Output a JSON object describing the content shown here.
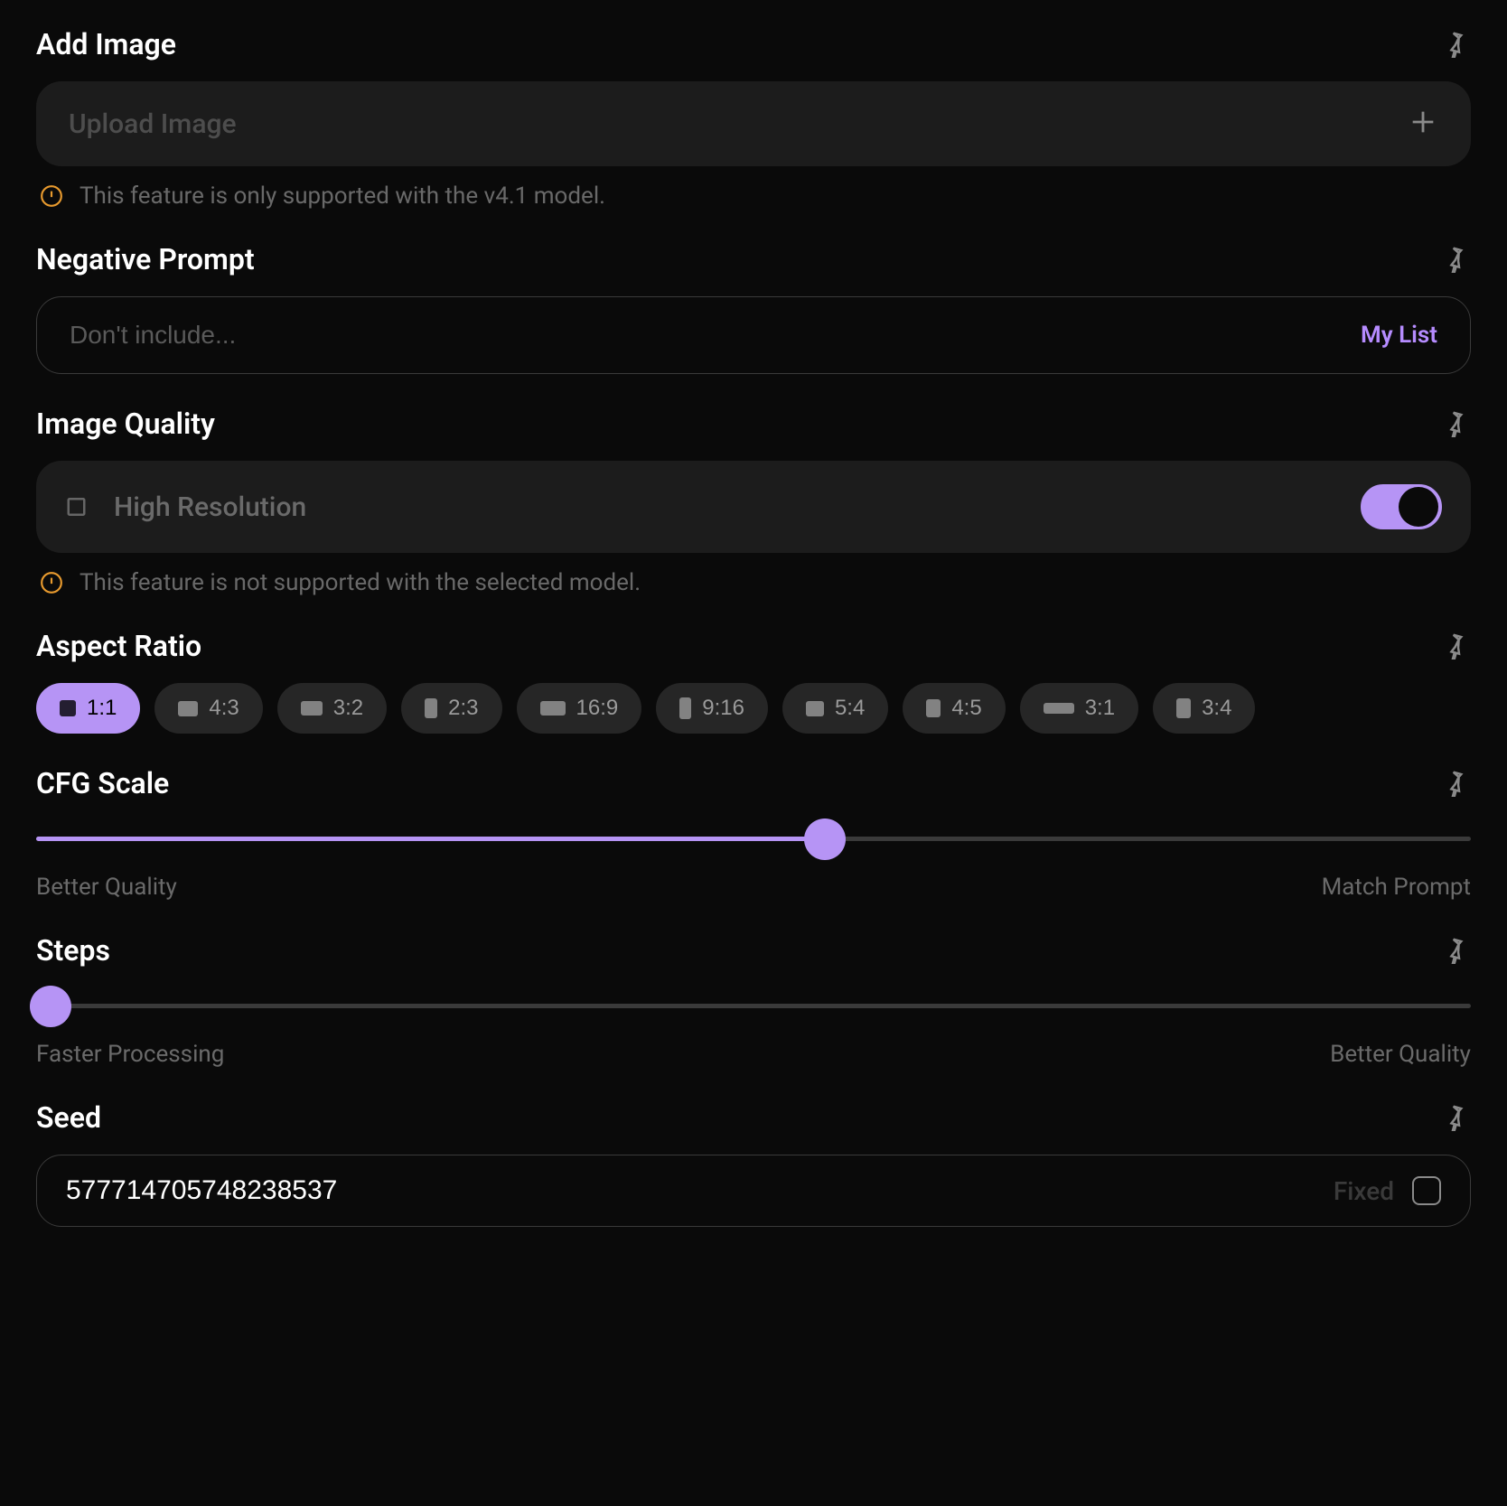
{
  "addImage": {
    "title": "Add Image",
    "uploadLabel": "Upload Image",
    "warning": "This feature is only supported with the v4.1 model."
  },
  "negativePrompt": {
    "title": "Negative Prompt",
    "placeholder": "Don't include...",
    "myList": "My List"
  },
  "imageQuality": {
    "title": "Image Quality",
    "label": "High Resolution",
    "toggled": true,
    "warning": "This feature is not supported with the selected model."
  },
  "aspectRatio": {
    "title": "Aspect Ratio",
    "options": [
      "1:1",
      "4:3",
      "3:2",
      "2:3",
      "16:9",
      "9:16",
      "5:4",
      "4:5",
      "3:1",
      "3:4"
    ],
    "selected": "1:1"
  },
  "cfgScale": {
    "title": "CFG Scale",
    "leftLabel": "Better Quality",
    "rightLabel": "Match Prompt",
    "percent": 55
  },
  "steps": {
    "title": "Steps",
    "leftLabel": "Faster Processing",
    "rightLabel": "Better Quality",
    "percent": 1
  },
  "seed": {
    "title": "Seed",
    "value": "577714705748238537",
    "fixedLabel": "Fixed",
    "fixed": false
  }
}
